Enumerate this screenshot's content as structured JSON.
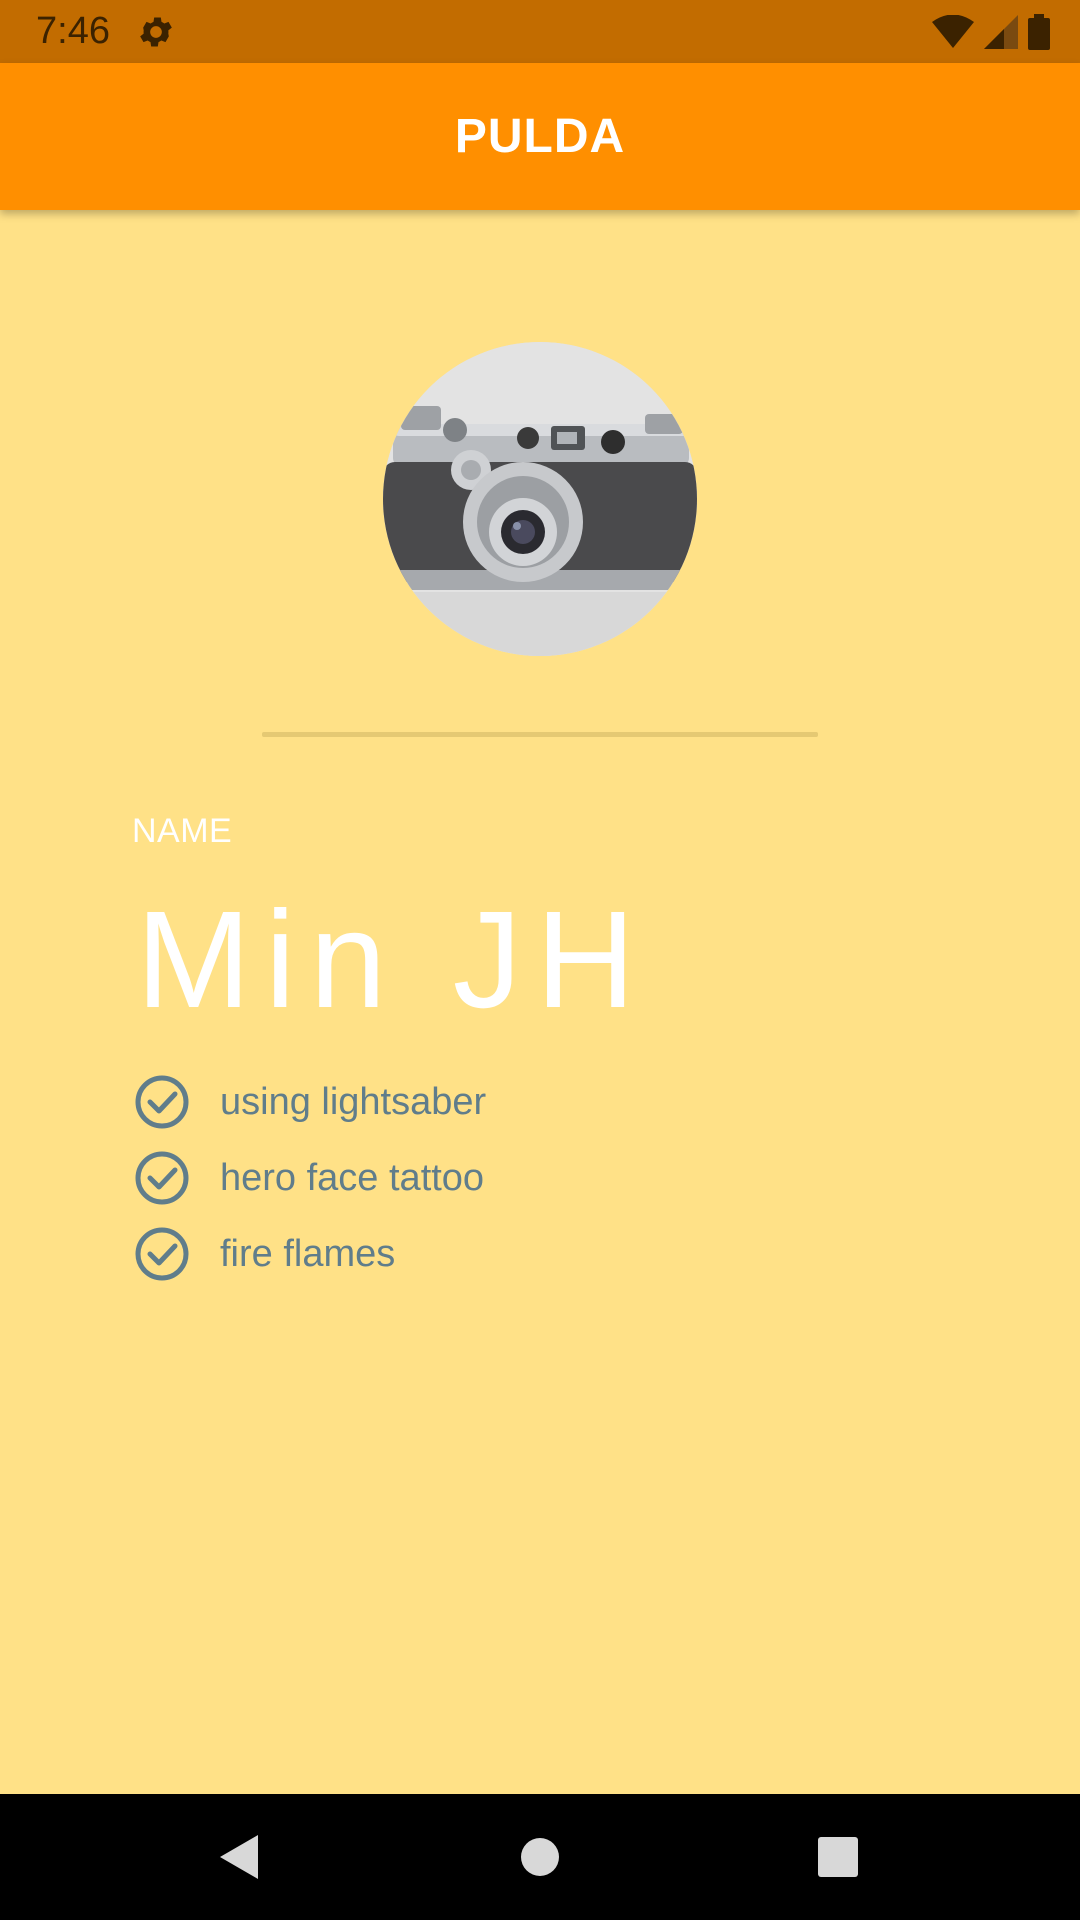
{
  "status_bar": {
    "time": "7:46",
    "icons": [
      "gear-icon",
      "wifi-icon",
      "signal-icon",
      "battery-icon"
    ]
  },
  "app_bar": {
    "title": "PULDA",
    "color": "#FF8F00"
  },
  "profile": {
    "avatar": "camera-photo",
    "name_label": "NAME",
    "name": "Min JH",
    "skills": [
      {
        "label": "using lightsaber",
        "icon": "check-circle-icon"
      },
      {
        "label": "hero face tattoo",
        "icon": "check-circle-icon"
      },
      {
        "label": "fire flames",
        "icon": "check-circle-icon"
      }
    ]
  },
  "colors": {
    "background": "#FFE187",
    "status_bar": "#C26C00",
    "skill_text": "#607D8B"
  },
  "nav_bar": {
    "buttons": [
      "back-icon",
      "home-icon",
      "recents-icon"
    ]
  }
}
